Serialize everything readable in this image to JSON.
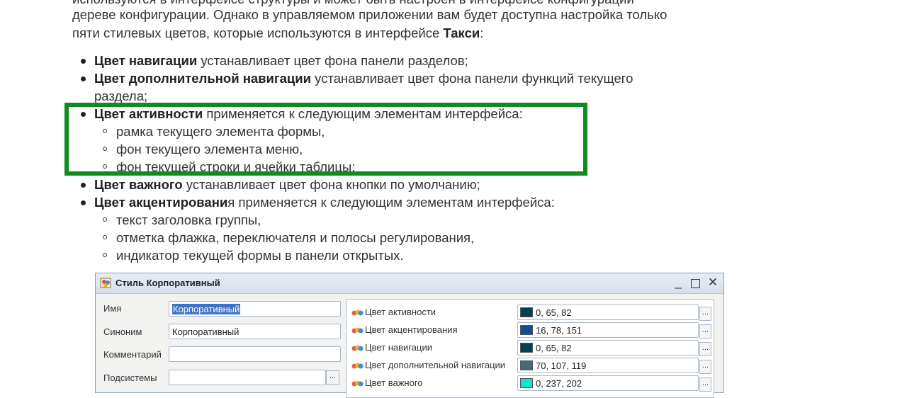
{
  "article": {
    "line_cut": "используются в интерфейсе структуры и может быть настроен в интерфейсе конфигурации",
    "line1": "дереве конфигурации. Однако в управляемом приложении вам будет доступна настройка только",
    "line2_prefix": "пяти стилевых цветов, которые используются в интерфейсе ",
    "line2_bold": "Такси",
    "line2_suffix": ":",
    "items": [
      {
        "type": "top",
        "bold": "Цвет навигации",
        "text": " устанавливает цвет фона панели разделов;"
      },
      {
        "type": "top",
        "bold": "Цвет дополнительной навигации",
        "text": " устанавливает цвет фона панели функций текущего"
      },
      {
        "type": "cont",
        "bold": "",
        "text": "раздела;"
      },
      {
        "type": "top",
        "bold": "Цвет активности",
        "text": " применяется к следующим элементам интерфейса:"
      },
      {
        "type": "sub",
        "bold": "",
        "text": "рамка текущего элемента формы,"
      },
      {
        "type": "sub",
        "bold": "",
        "text": "фон текущего элемента меню,"
      },
      {
        "type": "sub",
        "bold": "",
        "text": "фон текущей строки и ячейки таблицы;"
      },
      {
        "type": "top",
        "bold": "Цвет важного",
        "text": " устанавливает цвет фона кнопки по умолчанию;"
      },
      {
        "type": "top",
        "bold": "Цвет акцентировани",
        "text": "я применяется к следующим элементам интерфейса:"
      },
      {
        "type": "sub",
        "bold": "",
        "text": "текст заголовка группы,"
      },
      {
        "type": "sub",
        "bold": "",
        "text": "отметка флажка, переключателя и полосы регулирования,"
      },
      {
        "type": "sub",
        "bold": "",
        "text": "индикатор текущей формы в панели открытых."
      }
    ]
  },
  "highlight_color": "#118a1e",
  "window": {
    "title": "Стиль Корпоративный",
    "controls": {
      "minimize": "_",
      "close": "✕"
    },
    "labels": {
      "name": "Имя",
      "synonym": "Синоним",
      "comment": "Комментарий",
      "subsystems": "Подсистемы"
    },
    "fields": {
      "name": "Корпоративный",
      "synonym": "Корпоративный",
      "comment": "",
      "subsystems": ""
    },
    "dots": "...",
    "colors": [
      {
        "name": "Цвет активности",
        "value": "0, 65, 82",
        "hex": "#004152"
      },
      {
        "name": "Цвет акцентирования",
        "value": "16, 78, 151",
        "hex": "#104e97"
      },
      {
        "name": "Цвет навигации",
        "value": "0, 65, 82",
        "hex": "#004152"
      },
      {
        "name": "Цвет дополнительной навигации",
        "value": "70, 107, 119",
        "hex": "#466b77"
      },
      {
        "name": "Цвет важного",
        "value": "0, 237, 202",
        "hex": "#00edca"
      }
    ]
  }
}
